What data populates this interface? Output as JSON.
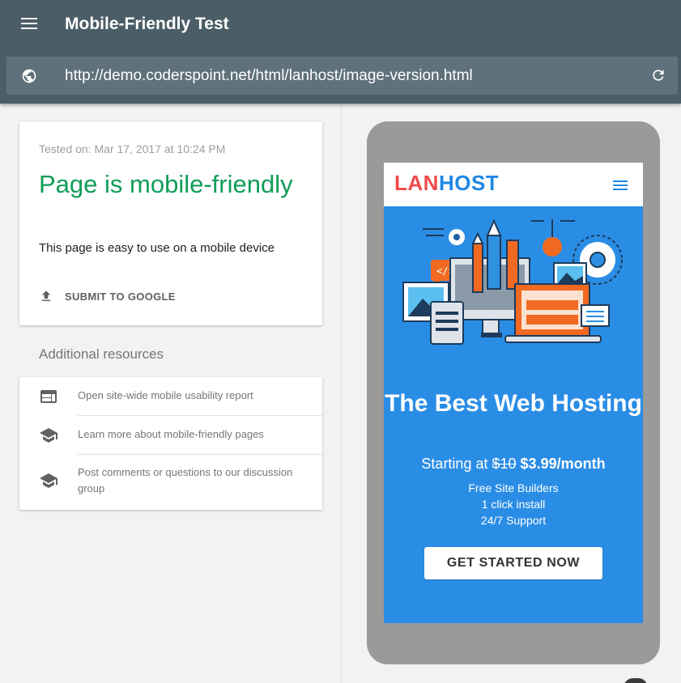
{
  "header": {
    "title": "Mobile-Friendly Test",
    "url": "http://demo.coderspoint.net/html/lanhost/image-version.html"
  },
  "result": {
    "tested_on": "Tested on: Mar 17, 2017 at 10:24 PM",
    "verdict": "Page is mobile-friendly",
    "description": "This page is easy to use on a mobile device",
    "submit_label": "SUBMIT TO GOOGLE"
  },
  "resources": {
    "title": "Additional resources",
    "items": [
      {
        "label": "Open site-wide mobile usability report",
        "icon": "web-report-icon"
      },
      {
        "label": "Learn more about mobile-friendly pages",
        "icon": "school-icon"
      },
      {
        "label": "Post comments or questions to our discussion group",
        "icon": "school-icon"
      }
    ]
  },
  "preview": {
    "logo_part1": "LAN",
    "logo_part2": "HOST",
    "hero_title": "The Best Web Hosting",
    "price_prefix": "Starting at",
    "price_old": "$10",
    "price_new": "$3.99/month",
    "features": [
      "Free Site Builders",
      "1 click install",
      "24/7 Support"
    ],
    "cta": "GET STARTED NOW"
  },
  "colors": {
    "header_bg": "#4b5d67",
    "verdict_green": "#0f9d58",
    "hero_blue": "#2a8de5",
    "logo_red": "#ef4b4b"
  }
}
